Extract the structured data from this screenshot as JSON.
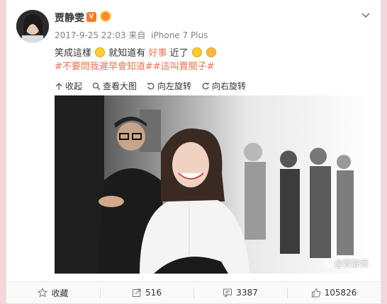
{
  "post": {
    "author": "贾静雯",
    "verified_badge": "V",
    "timestamp": "2017-9-25 22:03",
    "source_prefix": "来自",
    "source": "iPhone 7 Plus",
    "text_part1": "笑成這樣",
    "text_part2": "就知道有",
    "text_highlight": "好事",
    "text_part3": "近了",
    "hashtags": "#不要問我遲早會知道##這叫賣關子#"
  },
  "toolbar": {
    "collapse": "收起",
    "view_large": "查看大图",
    "rotate_left": "向左旋转",
    "rotate_right": "向右旋转"
  },
  "photo": {
    "watermark": "@贾静雯"
  },
  "footer": {
    "favorite": "收藏",
    "repost": "516",
    "comment": "3387",
    "like": "105826"
  },
  "colors": {
    "accent": "#eb7350",
    "background": "#f2d6dc",
    "verified": "#f47b20"
  },
  "icons": [
    "more-chevron-icon",
    "collapse-icon",
    "search-icon",
    "rotate-left-icon",
    "rotate-right-icon",
    "weibo-logo-icon",
    "star-icon",
    "repost-icon",
    "comment-icon",
    "like-icon"
  ]
}
